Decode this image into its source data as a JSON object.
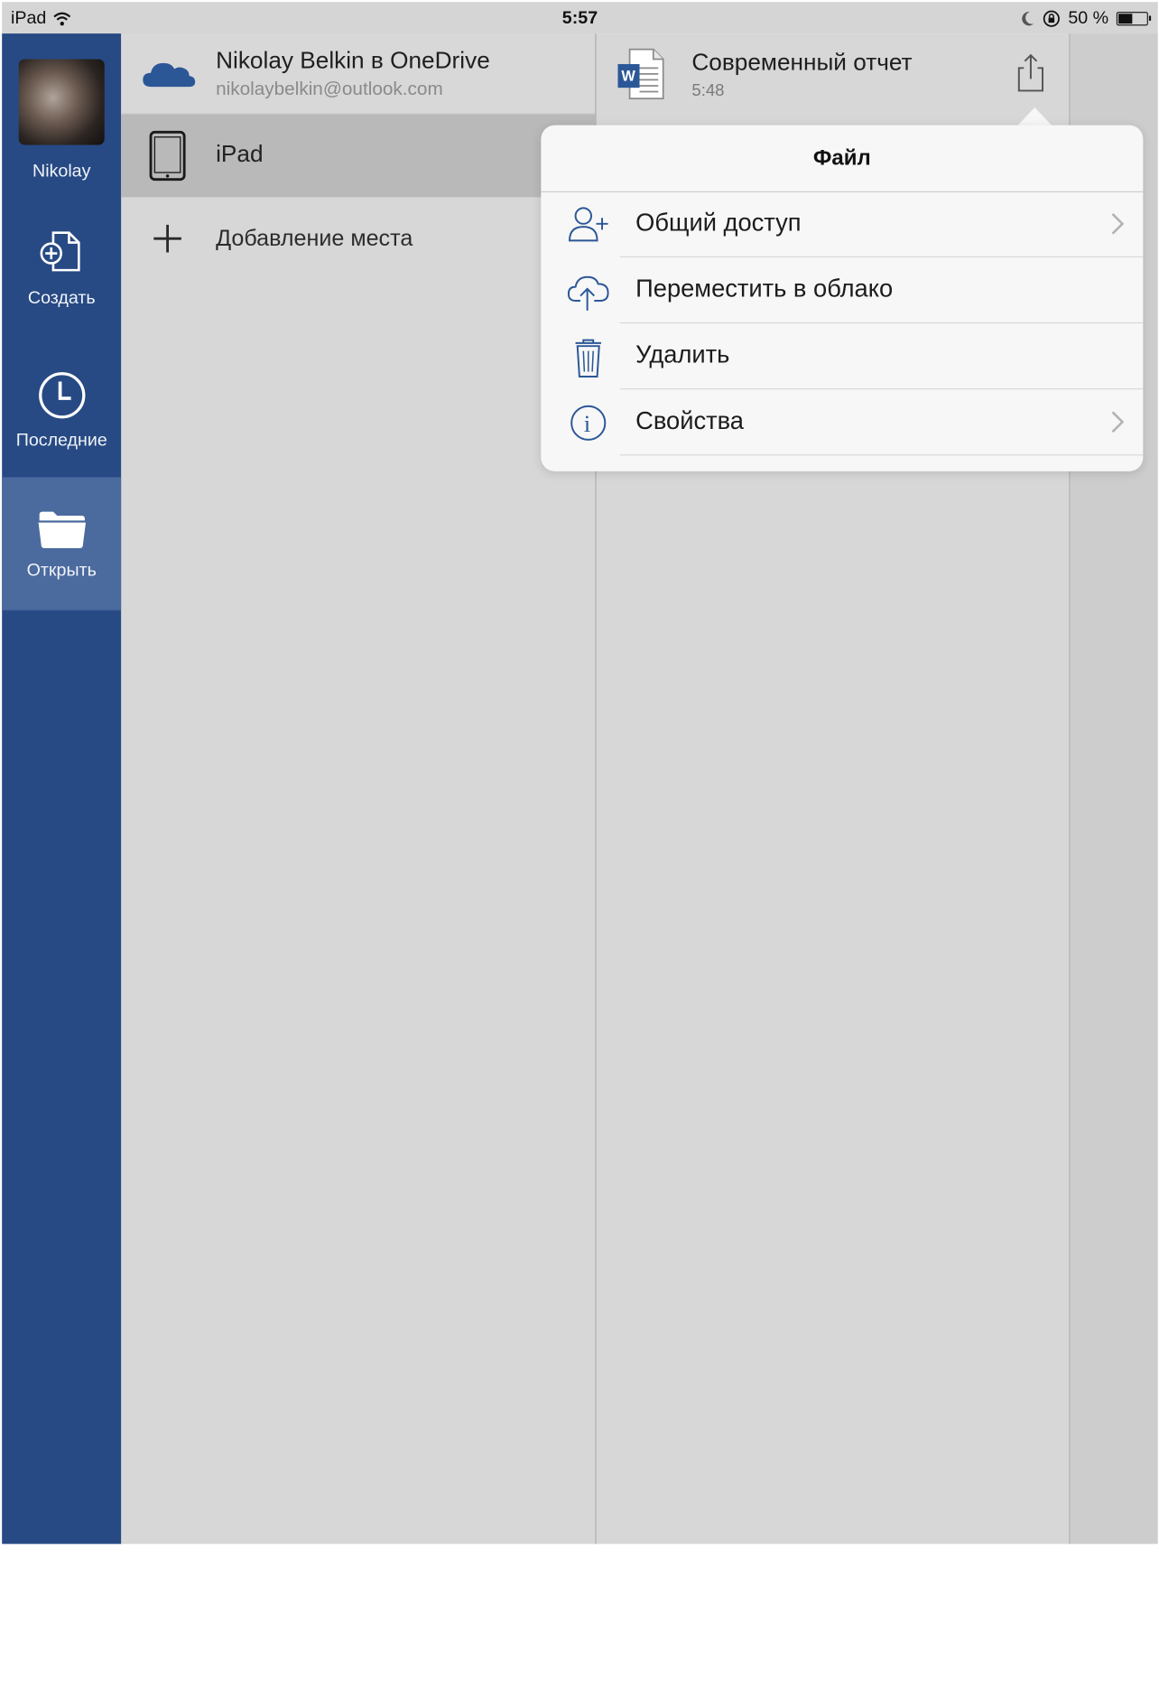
{
  "status_bar": {
    "device": "iPad",
    "time": "5:57",
    "battery_text": "50 %"
  },
  "rail": {
    "profile_name": "Nikolay",
    "items": [
      {
        "label": "Создать",
        "icon": "new-document-icon"
      },
      {
        "label": "Последние",
        "icon": "clock-icon"
      },
      {
        "label": "Открыть",
        "icon": "folder-icon"
      }
    ],
    "colors": {
      "background": "#274a84",
      "active": "#4b6a9e"
    }
  },
  "locations": {
    "onedrive": {
      "title": "Nikolay Belkin в OneDrive",
      "email": "nikolaybelkin@outlook.com",
      "icon": "onedrive-cloud-icon"
    },
    "ipad": {
      "label": "iPad",
      "icon": "ipad-device-icon"
    },
    "add_place": {
      "label": "Добавление места",
      "icon": "plus-icon"
    }
  },
  "document": {
    "title": "Современный отчет",
    "time": "5:48",
    "icon": "word-document-icon",
    "share_icon": "share-icon"
  },
  "popover": {
    "title": "Файл",
    "items": [
      {
        "label": "Общий доступ",
        "icon": "add-person-icon",
        "has_chevron": true
      },
      {
        "label": "Переместить в облако",
        "icon": "cloud-upload-icon",
        "has_chevron": false
      },
      {
        "label": "Удалить",
        "icon": "trash-icon",
        "has_chevron": false
      },
      {
        "label": "Свойства",
        "icon": "info-icon",
        "has_chevron": true
      }
    ],
    "accent_color": "#2b5797"
  }
}
